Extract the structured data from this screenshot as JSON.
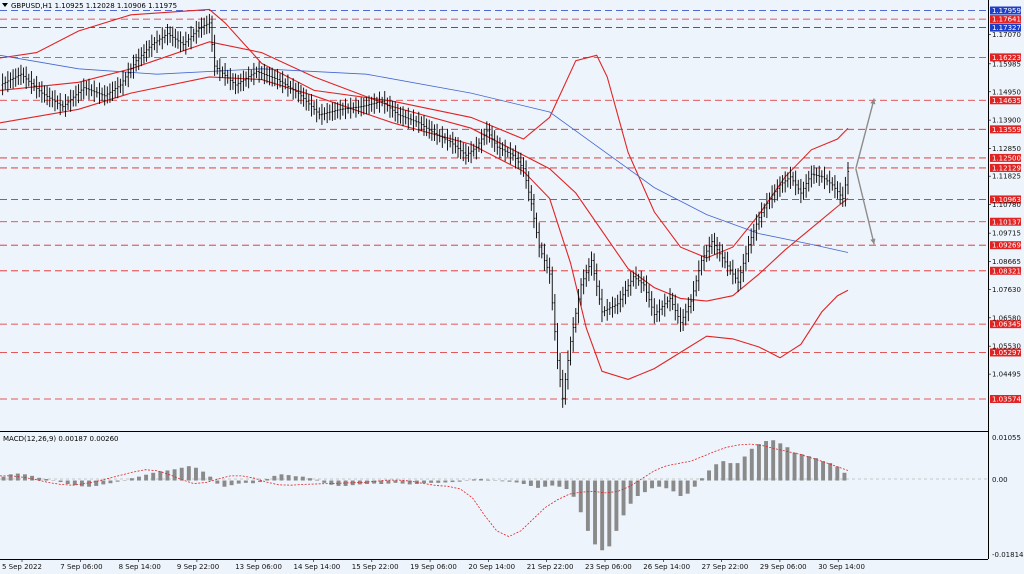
{
  "header": {
    "symbol_line": "GBPUSD,H1  1.10925 1.12028 1.10906 1.11975"
  },
  "macd": {
    "label": "MACD(12,26,9) 0.00187 0.00260",
    "axis_labels": [
      "0.01055",
      "0.00",
      "-0.01814"
    ]
  },
  "chart_data": [
    {
      "type": "line",
      "role": "price",
      "ylim": [
        1.025,
        1.182
      ],
      "x_labels": [
        "5 Sep 2022",
        "7 Sep 06:00",
        "8 Sep 14:00",
        "9 Sep 22:00",
        "13 Sep 06:00",
        "14 Sep 14:00",
        "15 Sep 22:00",
        "19 Sep 06:00",
        "20 Sep 14:00",
        "21 Sep 22:00",
        "23 Sep 06:00",
        "26 Sep 14:00",
        "27 Sep 22:00",
        "29 Sep 06:00",
        "30 Sep 14:00"
      ],
      "y_ticks": [
        "1.17070",
        "1.15985",
        "1.14950",
        "1.13900",
        "1.12850",
        "1.11825",
        "1.10780",
        "1.09715",
        "1.08665",
        "1.07630",
        "1.06580",
        "1.05530",
        "1.04495"
      ],
      "levels": [
        {
          "value": "1.17959",
          "color": "#1e3ec8"
        },
        {
          "value": "1.17641",
          "color": "#e02424"
        },
        {
          "value": "1.17327",
          "color": "#1e3ec8"
        },
        {
          "value": "1.16223",
          "color": "#e02424"
        },
        {
          "value": "1.14635",
          "color": "#e02424"
        },
        {
          "value": "1.13559",
          "color": "#e02424"
        },
        {
          "value": "1.12500",
          "color": "#e02424"
        },
        {
          "value": "1.12129",
          "color": "#e02424"
        },
        {
          "value": "1.10963",
          "color": "#e02424"
        },
        {
          "value": "1.10137",
          "color": "#e02424"
        },
        {
          "value": "1.09269",
          "color": "#e02424"
        },
        {
          "value": "1.08321",
          "color": "#e02424"
        },
        {
          "value": "1.06345",
          "color": "#e02424"
        },
        {
          "value": "1.05297",
          "color": "#e02424"
        },
        {
          "value": "1.03574",
          "color": "#e02424"
        }
      ],
      "series": [
        {
          "role": "price",
          "color": "#000000",
          "points": [
            [
              0,
              1.152
            ],
            [
              8,
              1.156
            ],
            [
              16,
              1.149
            ],
            [
              24,
              1.144
            ],
            [
              32,
              1.151
            ],
            [
              40,
              1.148
            ],
            [
              46,
              1.152
            ],
            [
              52,
              1.161
            ],
            [
              58,
              1.167
            ],
            [
              64,
              1.171
            ],
            [
              70,
              1.167
            ],
            [
              76,
              1.173
            ],
            [
              80,
              1.175
            ],
            [
              82,
              1.159
            ],
            [
              90,
              1.152
            ],
            [
              98,
              1.157
            ],
            [
              106,
              1.154
            ],
            [
              114,
              1.149
            ],
            [
              122,
              1.141
            ],
            [
              130,
              1.143
            ],
            [
              138,
              1.144
            ],
            [
              146,
              1.146
            ],
            [
              152,
              1.141
            ],
            [
              160,
              1.138
            ],
            [
              166,
              1.134
            ],
            [
              172,
              1.131
            ],
            [
              178,
              1.126
            ],
            [
              182,
              1.129
            ],
            [
              186,
              1.135
            ],
            [
              190,
              1.129
            ],
            [
              196,
              1.126
            ],
            [
              200,
              1.121
            ],
            [
              203,
              1.108
            ],
            [
              206,
              1.092
            ],
            [
              210,
              1.082
            ],
            [
              213,
              1.05
            ],
            [
              215,
              1.036
            ],
            [
              218,
              1.057
            ],
            [
              222,
              1.078
            ],
            [
              226,
              1.087
            ],
            [
              230,
              1.068
            ],
            [
              236,
              1.071
            ],
            [
              242,
              1.081
            ],
            [
              246,
              1.078
            ],
            [
              250,
              1.067
            ],
            [
              256,
              1.073
            ],
            [
              260,
              1.064
            ],
            [
              264,
              1.072
            ],
            [
              268,
              1.087
            ],
            [
              272,
              1.094
            ],
            [
              278,
              1.085
            ],
            [
              282,
              1.079
            ],
            [
              286,
              1.093
            ],
            [
              290,
              1.103
            ],
            [
              294,
              1.11
            ],
            [
              298,
              1.115
            ],
            [
              302,
              1.118
            ],
            [
              306,
              1.112
            ],
            [
              310,
              1.119
            ],
            [
              314,
              1.118
            ],
            [
              318,
              1.115
            ],
            [
              322,
              1.11
            ],
            [
              324,
              1.12
            ]
          ]
        },
        {
          "role": "bb_upper",
          "color": "#e02424",
          "points": [
            [
              0,
              1.162
            ],
            [
              14,
              1.164
            ],
            [
              30,
              1.172
            ],
            [
              50,
              1.178
            ],
            [
              80,
              1.18
            ],
            [
              86,
              1.175
            ],
            [
              100,
              1.16
            ],
            [
              120,
              1.15
            ],
            [
              150,
              1.146
            ],
            [
              180,
              1.14
            ],
            [
              200,
              1.132
            ],
            [
              210,
              1.14
            ],
            [
              220,
              1.161
            ],
            [
              228,
              1.163
            ],
            [
              232,
              1.155
            ],
            [
              240,
              1.127
            ],
            [
              250,
              1.105
            ],
            [
              260,
              1.092
            ],
            [
              270,
              1.088
            ],
            [
              280,
              1.092
            ],
            [
              290,
              1.104
            ],
            [
              300,
              1.118
            ],
            [
              310,
              1.128
            ],
            [
              320,
              1.132
            ],
            [
              324,
              1.136
            ]
          ]
        },
        {
          "role": "bb_mid",
          "color": "#e02424",
          "points": [
            [
              0,
              1.15
            ],
            [
              30,
              1.153
            ],
            [
              50,
              1.158
            ],
            [
              80,
              1.168
            ],
            [
              100,
              1.164
            ],
            [
              120,
              1.155
            ],
            [
              150,
              1.144
            ],
            [
              180,
              1.136
            ],
            [
              200,
              1.126
            ],
            [
              210,
              1.121
            ],
            [
              220,
              1.112
            ],
            [
              230,
              1.098
            ],
            [
              240,
              1.084
            ],
            [
              250,
              1.077
            ],
            [
              260,
              1.073
            ],
            [
              270,
              1.072
            ],
            [
              280,
              1.074
            ],
            [
              290,
              1.082
            ],
            [
              300,
              1.091
            ],
            [
              310,
              1.099
            ],
            [
              320,
              1.107
            ],
            [
              324,
              1.11
            ]
          ]
        },
        {
          "role": "bb_lower",
          "color": "#e02424",
          "points": [
            [
              0,
              1.138
            ],
            [
              30,
              1.143
            ],
            [
              50,
              1.149
            ],
            [
              80,
              1.155
            ],
            [
              100,
              1.154
            ],
            [
              120,
              1.148
            ],
            [
              150,
              1.138
            ],
            [
              180,
              1.13
            ],
            [
              200,
              1.12
            ],
            [
              210,
              1.11
            ],
            [
              218,
              1.086
            ],
            [
              224,
              1.062
            ],
            [
              230,
              1.046
            ],
            [
              240,
              1.043
            ],
            [
              250,
              1.047
            ],
            [
              260,
              1.053
            ],
            [
              270,
              1.059
            ],
            [
              280,
              1.058
            ],
            [
              290,
              1.055
            ],
            [
              298,
              1.051
            ],
            [
              306,
              1.056
            ],
            [
              314,
              1.068
            ],
            [
              320,
              1.074
            ],
            [
              324,
              1.076
            ]
          ]
        },
        {
          "role": "ma",
          "color": "#4466d0",
          "points": [
            [
              0,
              1.163
            ],
            [
              30,
              1.158
            ],
            [
              60,
              1.156
            ],
            [
              100,
              1.158
            ],
            [
              140,
              1.156
            ],
            [
              180,
              1.149
            ],
            [
              210,
              1.142
            ],
            [
              230,
              1.128
            ],
            [
              250,
              1.114
            ],
            [
              270,
              1.104
            ],
            [
              290,
              1.097
            ],
            [
              310,
              1.093
            ],
            [
              324,
              1.09
            ]
          ]
        }
      ],
      "arrows": [
        {
          "from": [
            327,
            1.121
          ],
          "to": [
            334,
            1.147
          ]
        },
        {
          "from": [
            327,
            1.121
          ],
          "to": [
            334,
            1.093
          ]
        }
      ]
    },
    {
      "type": "bar",
      "role": "macd_histogram",
      "ylim": [
        -0.0195,
        0.0115
      ],
      "bars": [
        0.001,
        0.0016,
        0.0018,
        0.0016,
        0.0012,
        0.0007,
        0.0004,
        0.0001,
        -0.0004,
        -0.0009,
        -0.0012,
        -0.0015,
        -0.0016,
        -0.0014,
        -0.001,
        -0.0007,
        -0.0003,
        0.0001,
        0.0006,
        0.001,
        0.0015,
        0.002,
        0.0024,
        0.0026,
        0.0029,
        0.0033,
        0.0037,
        0.0033,
        0.0023,
        0.001,
        -0.0008,
        -0.0016,
        -0.0012,
        -0.0008,
        -0.0006,
        -0.0007,
        -0.0004,
        0.0004,
        0.0012,
        0.0016,
        0.0014,
        0.0011,
        0.001,
        0.0006,
        0.0002,
        -0.0006,
        -0.0011,
        -0.0014,
        -0.0014,
        -0.0012,
        -0.001,
        -0.0009,
        -0.0008,
        -0.0009,
        -0.0008,
        -0.0006,
        -0.0008,
        -0.001,
        -0.0009,
        -0.0007,
        -0.0006,
        -0.0006,
        -0.0005,
        -0.0004,
        -0.0003,
        -0.0001,
        0.0003,
        0.0004,
        0.0002,
        -0.0001,
        -0.0002,
        -0.0003,
        -0.0005,
        -0.0009,
        -0.0014,
        -0.0019,
        -0.0016,
        -0.0013,
        -0.0016,
        -0.0022,
        -0.0042,
        -0.0082,
        -0.013,
        -0.0165,
        -0.018,
        -0.017,
        -0.013,
        -0.009,
        -0.006,
        -0.004,
        -0.003,
        -0.002,
        -0.0016,
        -0.002,
        -0.0028,
        -0.004,
        -0.0034,
        -0.0016,
        0.0006,
        0.0026,
        0.0042,
        0.005,
        0.0045,
        0.0045,
        0.0062,
        0.0082,
        0.0094,
        0.0102,
        0.0104,
        0.0096,
        0.0086,
        0.0072,
        0.0068,
        0.0063,
        0.0058,
        0.005,
        0.0045,
        0.0036,
        0.002
      ],
      "signal": [
        0.0012,
        0.0012,
        0.0008,
        0.0002,
        -0.0005,
        -0.001,
        -0.0012,
        -0.0008,
        -0.0002,
        0.0006,
        0.0014,
        0.0022,
        0.0028,
        0.0025,
        0.0015,
        0.0002,
        -0.0008,
        -0.0005,
        0.0004,
        0.0012,
        0.0012,
        0.0006,
        -0.0004,
        -0.0011,
        -0.0012,
        -0.001,
        -0.0009,
        -0.0008,
        -0.0007,
        -0.0006,
        -0.0005,
        -0.0002,
        0.0001,
        0.0001,
        -0.0002,
        -0.0008,
        -0.0013,
        -0.0015,
        -0.0022,
        -0.0045,
        -0.009,
        -0.013,
        -0.0145,
        -0.013,
        -0.01,
        -0.007,
        -0.005,
        -0.0035,
        -0.003,
        -0.0028,
        -0.0032,
        -0.0028,
        -0.0015,
        0.0005,
        0.0025,
        0.0038,
        0.0044,
        0.005,
        0.0062,
        0.0075,
        0.0086,
        0.0092,
        0.0094,
        0.009,
        0.0082,
        0.0075,
        0.0068,
        0.0058,
        0.0048,
        0.0037,
        0.0026
      ]
    }
  ]
}
